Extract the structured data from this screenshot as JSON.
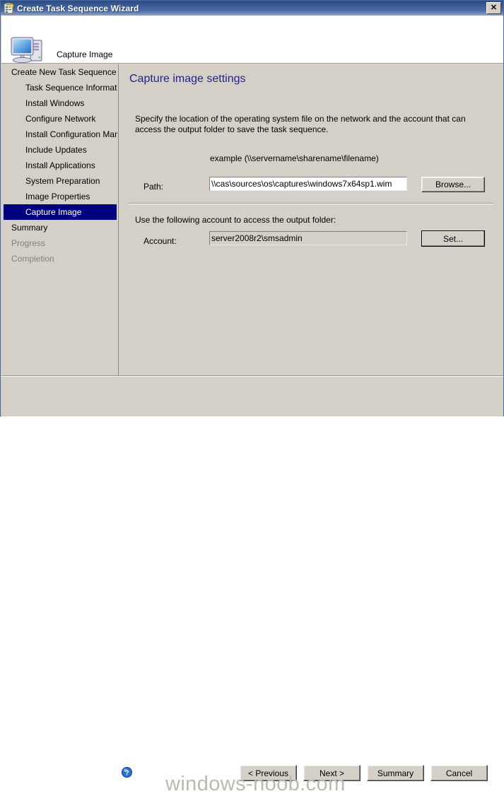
{
  "window": {
    "title": "Create Task Sequence Wizard",
    "title_icon": "task-sequence-clipboard-icon",
    "close_label": "Close",
    "border_color": "#4a6a9e",
    "titlebar_gradient_top": "#2c4c85",
    "titlebar_gradient_bottom": "#8fa3c4"
  },
  "banner": {
    "icon": "computer-icon",
    "title": "Capture Image",
    "background": "#ffffff"
  },
  "sidebar": {
    "selected_index": 9,
    "selected_background": "#000080",
    "selected_color": "#ffffff",
    "items": [
      {
        "label": "Create New Task Sequence",
        "level": "root",
        "state": "normal"
      },
      {
        "label": "Task Sequence Information",
        "level": "child",
        "state": "normal"
      },
      {
        "label": "Install Windows",
        "level": "child",
        "state": "normal"
      },
      {
        "label": "Configure Network",
        "level": "child",
        "state": "normal"
      },
      {
        "label": "Install Configuration Manag",
        "level": "child",
        "state": "normal"
      },
      {
        "label": "Include Updates",
        "level": "child",
        "state": "normal"
      },
      {
        "label": "Install Applications",
        "level": "child",
        "state": "normal"
      },
      {
        "label": "System Preparation",
        "level": "child",
        "state": "normal"
      },
      {
        "label": "Image Properties",
        "level": "child",
        "state": "normal"
      },
      {
        "label": "Capture Image",
        "level": "child",
        "state": "selected"
      },
      {
        "label": "Summary",
        "level": "root",
        "state": "normal"
      },
      {
        "label": "Progress",
        "level": "root",
        "state": "disabled"
      },
      {
        "label": "Completion",
        "level": "root",
        "state": "disabled"
      }
    ],
    "scrollbar": {
      "left_arrow": "◄",
      "right_arrow": "►"
    }
  },
  "main": {
    "heading": "Capture image settings",
    "heading_color": "#23238e",
    "instructions": "Specify the location of the operating system file on the network and the account that can access the output folder to save the task sequence.",
    "example_hint": "example (\\\\servername\\sharename\\filename)",
    "path": {
      "label": "Path:",
      "value": "\\\\cas\\sources\\os\\captures\\windows7x64sp1.wim",
      "placeholder": "",
      "browse_label": "Browse..."
    },
    "account": {
      "description": "Use the following account to access the output folder:",
      "label": "Account:",
      "value": "server2008r2\\smsadmin",
      "placeholder": "",
      "set_label": "Set..."
    }
  },
  "footer": {
    "help_icon": "help-question-icon",
    "buttons": [
      {
        "name": "previous",
        "label": "< Previous"
      },
      {
        "name": "next",
        "label": "Next >"
      },
      {
        "name": "summary",
        "label": "Summary"
      },
      {
        "name": "cancel",
        "label": "Cancel"
      }
    ],
    "watermark": "windows-noob.com"
  }
}
